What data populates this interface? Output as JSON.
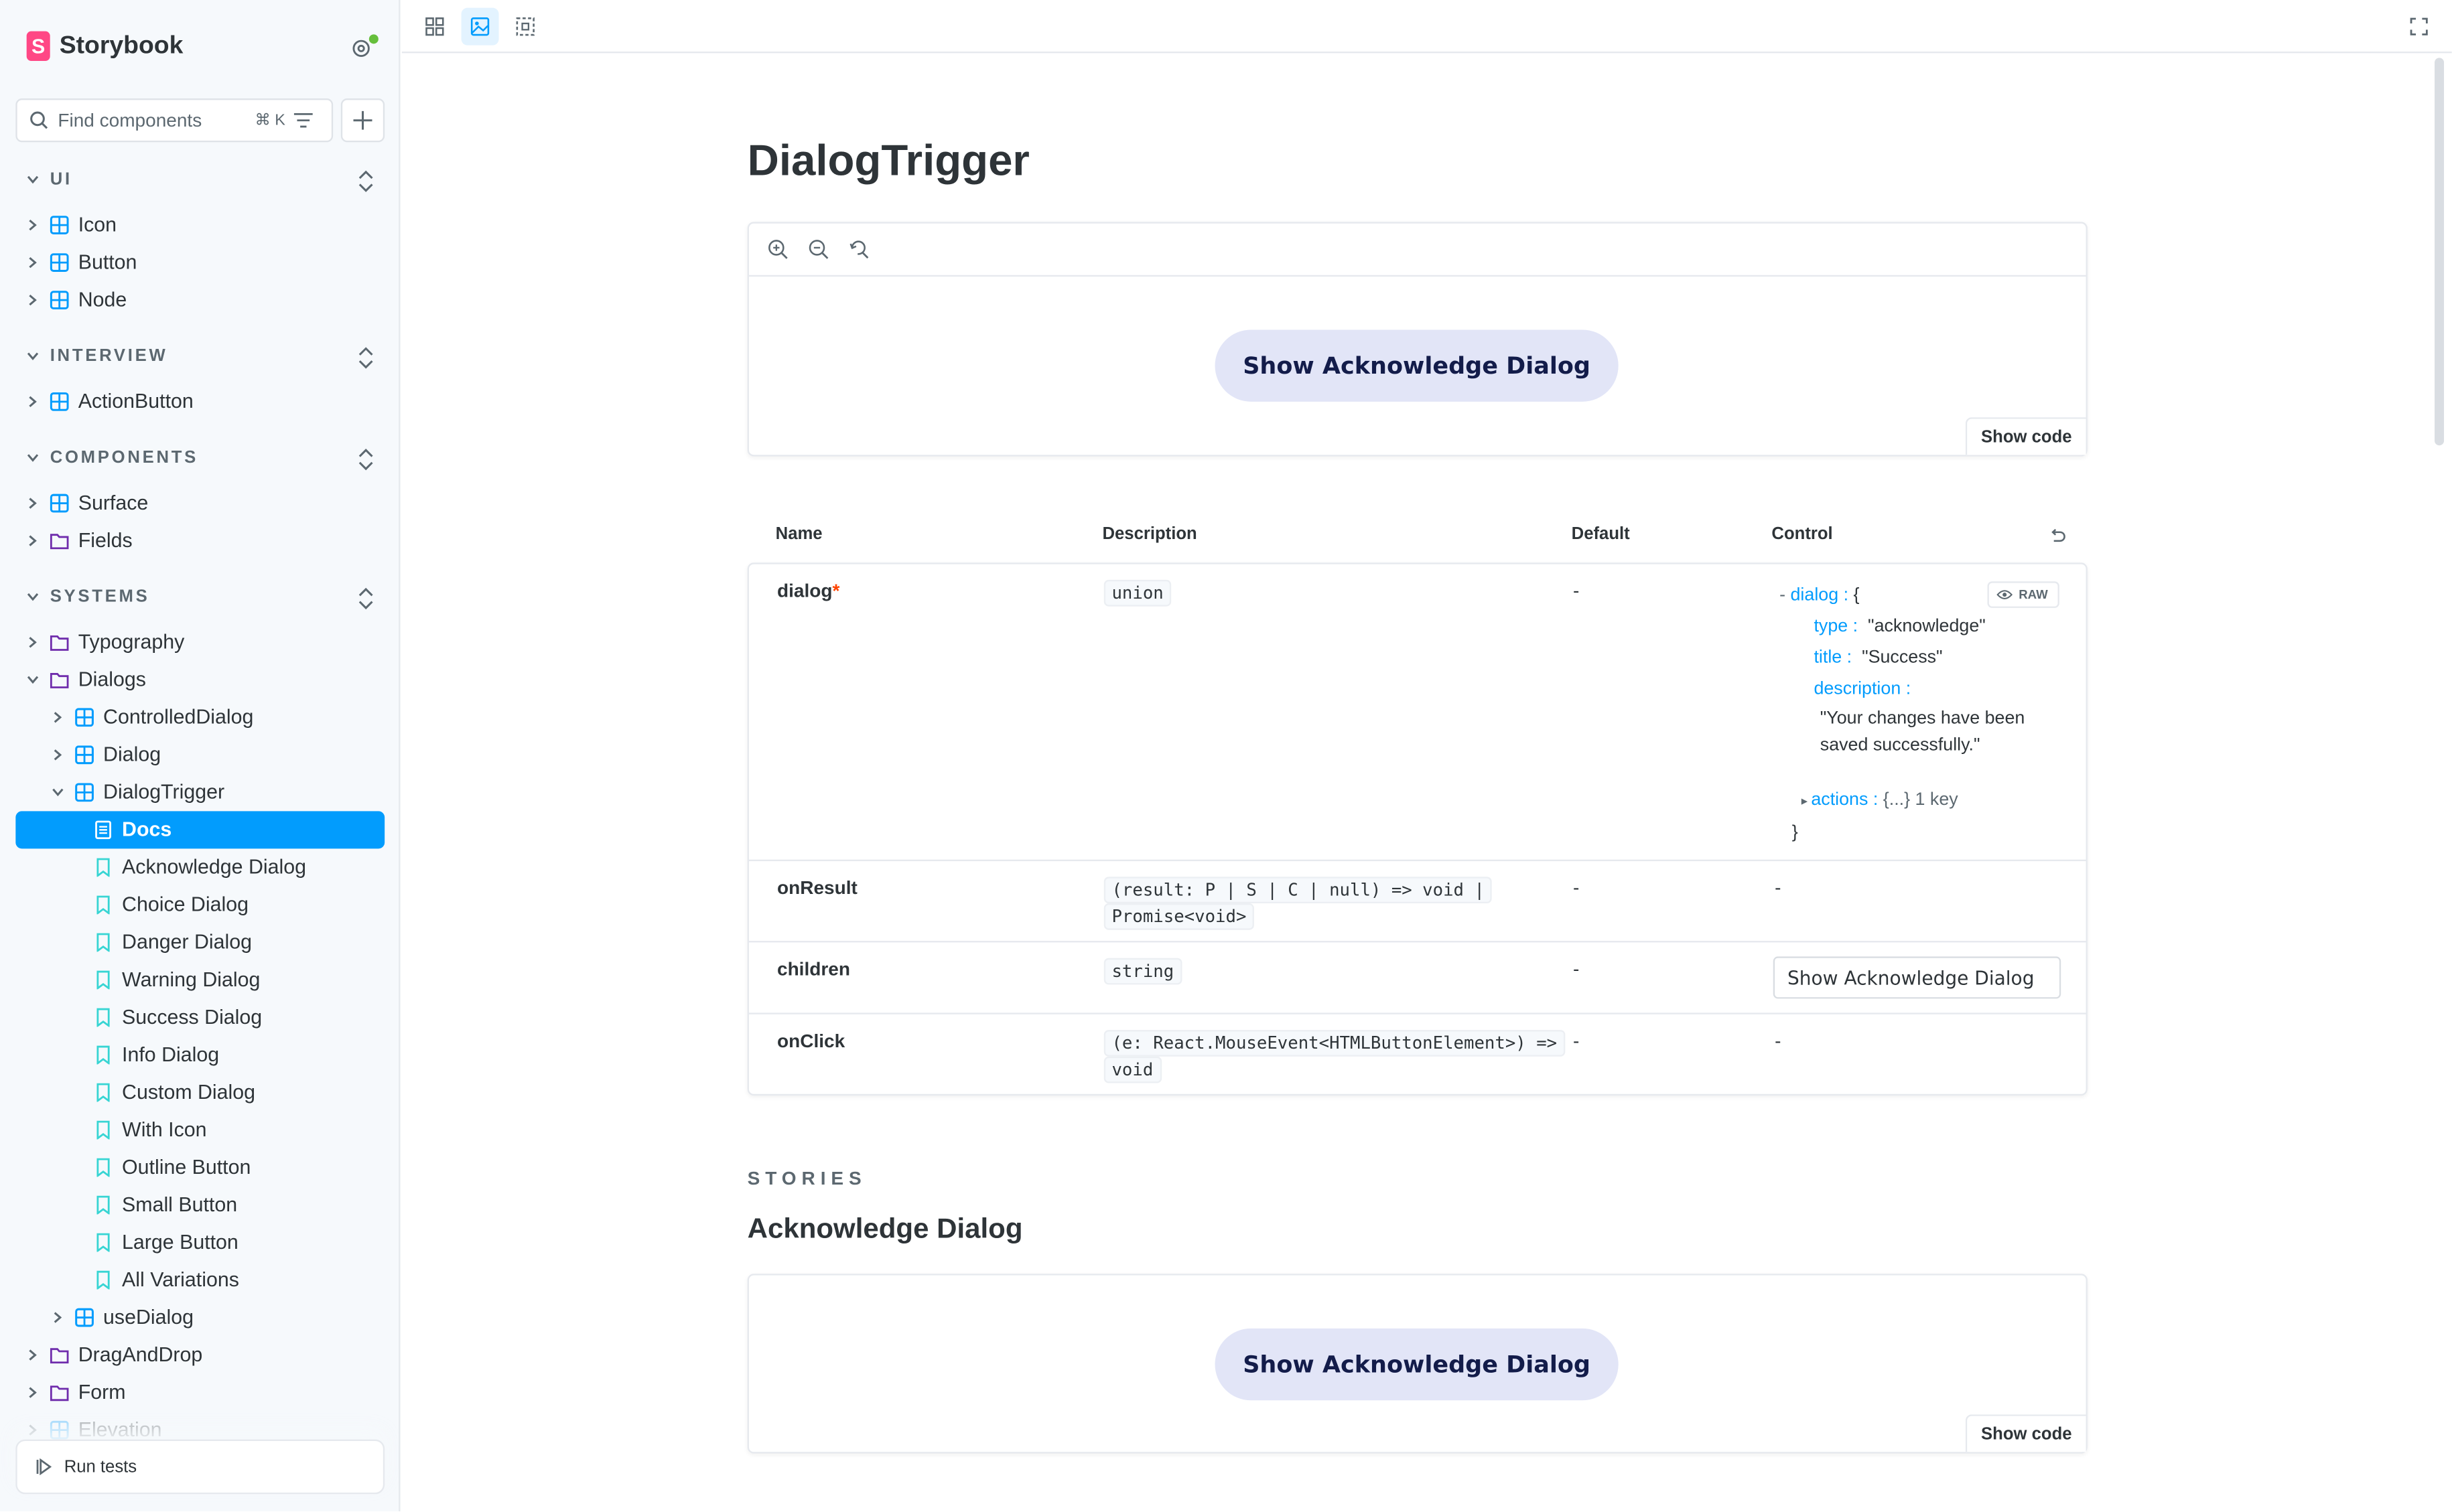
{
  "brand": {
    "name": "Storybook",
    "logo_letter": "S"
  },
  "search": {
    "placeholder": "Find components",
    "shortcut": "⌘ K"
  },
  "sections": {
    "ui": "UI",
    "interview": "INTERVIEW",
    "components": "COMPONENTS",
    "systems": "SYSTEMS"
  },
  "tree": {
    "icon": "Icon",
    "button": "Button",
    "node": "Node",
    "actionbutton": "ActionButton",
    "surface": "Surface",
    "fields": "Fields",
    "typography": "Typography",
    "dialogs": "Dialogs",
    "controlleddialog": "ControlledDialog",
    "dialog": "Dialog",
    "dialogtrigger": "DialogTrigger",
    "docs": "Docs",
    "stories": [
      "Acknowledge Dialog",
      "Choice Dialog",
      "Danger Dialog",
      "Warning Dialog",
      "Success Dialog",
      "Info Dialog",
      "Custom Dialog",
      "With Icon",
      "Outline Button",
      "Small Button",
      "Large Button",
      "All Variations"
    ],
    "usedialog": "useDialog",
    "draganddrop": "DragAndDrop",
    "form": "Form",
    "elevation": "Elevation"
  },
  "run_tests": "Run tests",
  "page": {
    "title": "DialogTrigger"
  },
  "preview": {
    "button_label": "Show Acknowledge Dialog",
    "show_code": "Show code"
  },
  "args_table": {
    "headers": {
      "name": "Name",
      "description": "Description",
      "default": "Default",
      "control": "Control"
    },
    "rows": {
      "dialog": {
        "name": "dialog",
        "required": "*",
        "type": "union",
        "default": "-"
      },
      "onResult": {
        "name": "onResult",
        "type_line1": "(result: P | S | C | null) => void |",
        "type_line2": "Promise<void>",
        "default": "-",
        "control": "-"
      },
      "children": {
        "name": "children",
        "type": "string",
        "default": "-",
        "control_value": "Show Acknowledge Dialog"
      },
      "onClick": {
        "name": "onClick",
        "type_line1": "(e: React.MouseEvent<HTMLButtonElement>) =>",
        "type_line2": "void",
        "default": "-",
        "control": "-"
      }
    },
    "json": {
      "root_key": "dialog :",
      "open": "{",
      "type_key": "type :",
      "type_val": "\"acknowledge\"",
      "title_key": "title :",
      "title_val": "\"Success\"",
      "desc_key": "description :",
      "desc_val_1": "\"Your changes have been",
      "desc_val_2": "saved successfully.\"",
      "actions_key": "actions :",
      "actions_val": "{...} 1 key",
      "close": "}",
      "raw_label": "RAW"
    }
  },
  "stories_section": {
    "label": "STORIES",
    "story_title": "Acknowledge Dialog",
    "button_label": "Show Acknowledge Dialog",
    "show_code": "Show code"
  },
  "colors": {
    "accent": "#029cfd",
    "brand": "#ff4785",
    "required": "#ff4400",
    "story_button_bg": "#e2e5f7"
  }
}
